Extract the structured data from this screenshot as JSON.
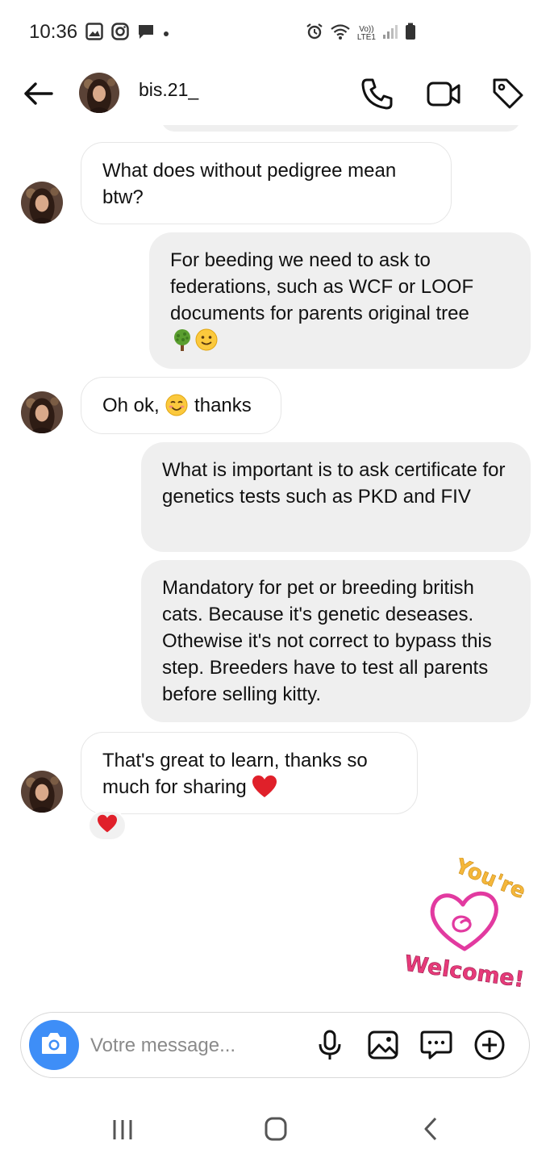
{
  "status_bar": {
    "time": "10:36",
    "network_label_top": "Vo))",
    "network_label_bottom": "LTE1"
  },
  "header": {
    "username": "bis.21_",
    "icons": [
      "back-arrow-icon",
      "phone-icon",
      "video-camera-icon",
      "tag-icon"
    ]
  },
  "messages": [
    {
      "from": "them",
      "text": "What does without pedigree mean btw?"
    },
    {
      "from": "me",
      "text": "For beeding we need to ask to federations, such as WCF or LOOF documents for parents original tree",
      "emojis": [
        "tree-emoji",
        "slightly-smiling-face-emoji"
      ]
    },
    {
      "from": "them",
      "text_before": "Oh ok,",
      "text_after": "thanks",
      "emoji": "smiling-face-emoji"
    },
    {
      "from": "me",
      "text": "What is important is to ask certificate for genetics tests such as PKD and FIV"
    },
    {
      "from": "me",
      "text": "Mandatory for pet or breeding british cats. Because it's genetic deseases. Othewise it's not correct to bypass this step. Breeders have to test all parents before selling kitty."
    },
    {
      "from": "them",
      "text": "That's great to learn, thanks so much for sharing",
      "emoji": "red-heart-emoji",
      "reaction": "red-heart-emoji"
    }
  ],
  "sticker": {
    "line1": "You're",
    "line2": "Welcome!"
  },
  "composer": {
    "placeholder": "Votre message..."
  },
  "colors": {
    "accent_blue": "#3e8ef7",
    "outgoing_bubble": "#efefef",
    "heart_red": "#e0202a"
  }
}
